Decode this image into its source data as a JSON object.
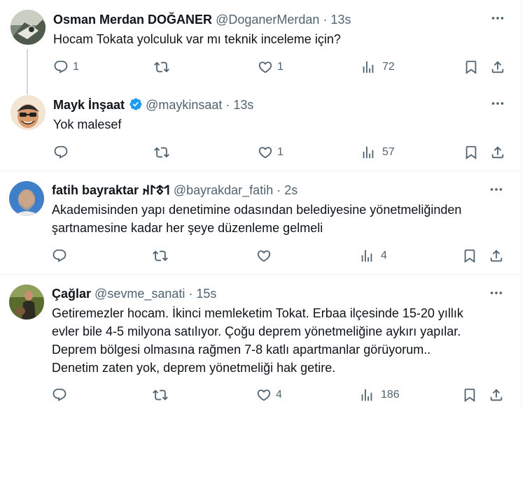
{
  "tweets": [
    {
      "name": "Osman Merdan DOĞANER",
      "handle": "@DoganerMerdan",
      "time": "· 13s",
      "text": "Hocam Tokata yolculuk var mı teknik inceleme için?",
      "replies": "1",
      "retweets": "",
      "likes": "1",
      "views": "72"
    },
    {
      "name": "Mayk İnşaat",
      "handle": "@maykinsaat",
      "time": "· 13s",
      "text": "Yok malesef",
      "replies": "",
      "retweets": "",
      "likes": "1",
      "views": "57"
    },
    {
      "name": "fatih bayraktar 𐰯𐱃𐰃𐰴",
      "handle": "@bayrakdar_fatih",
      "time": "· 2s",
      "text_lines": [
        "Akademisinden yapı denetimine odasından belediyesine yönetmeliğinden",
        "şartnamesine kadar her şeye düzenleme gelmeli"
      ],
      "replies": "",
      "retweets": "",
      "likes": "",
      "views": "4"
    },
    {
      "name": "Çağlar",
      "handle": "@sevme_sanati",
      "time": "· 15s",
      "text_lines": [
        "Getiremezler hocam. İkinci memleketim Tokat. Erbaa ilçesinde 15-20 yıllık",
        "evler bile 4-5 milyona satılıyor. Çoğu deprem yönetmeliğine aykırı yapılar.",
        "Deprem bölgesi olmasına rağmen 7-8 katlı apartmanlar görüyorum..",
        "Denetim zaten yok, deprem yönetmeliği hak getire."
      ],
      "replies": "",
      "retweets": "",
      "likes": "4",
      "views": "186"
    }
  ],
  "icons": {
    "more": "more-icon",
    "reply": "reply-icon",
    "retweet": "retweet-icon",
    "like": "like-icon",
    "views": "views-icon",
    "bookmark": "bookmark-icon",
    "share": "share-icon",
    "verified": "verified-badge-icon"
  },
  "colors": {
    "text": "#0f1419",
    "muted": "#536471",
    "verified": "#1d9bf0",
    "thread_line": "#cfd9de"
  }
}
